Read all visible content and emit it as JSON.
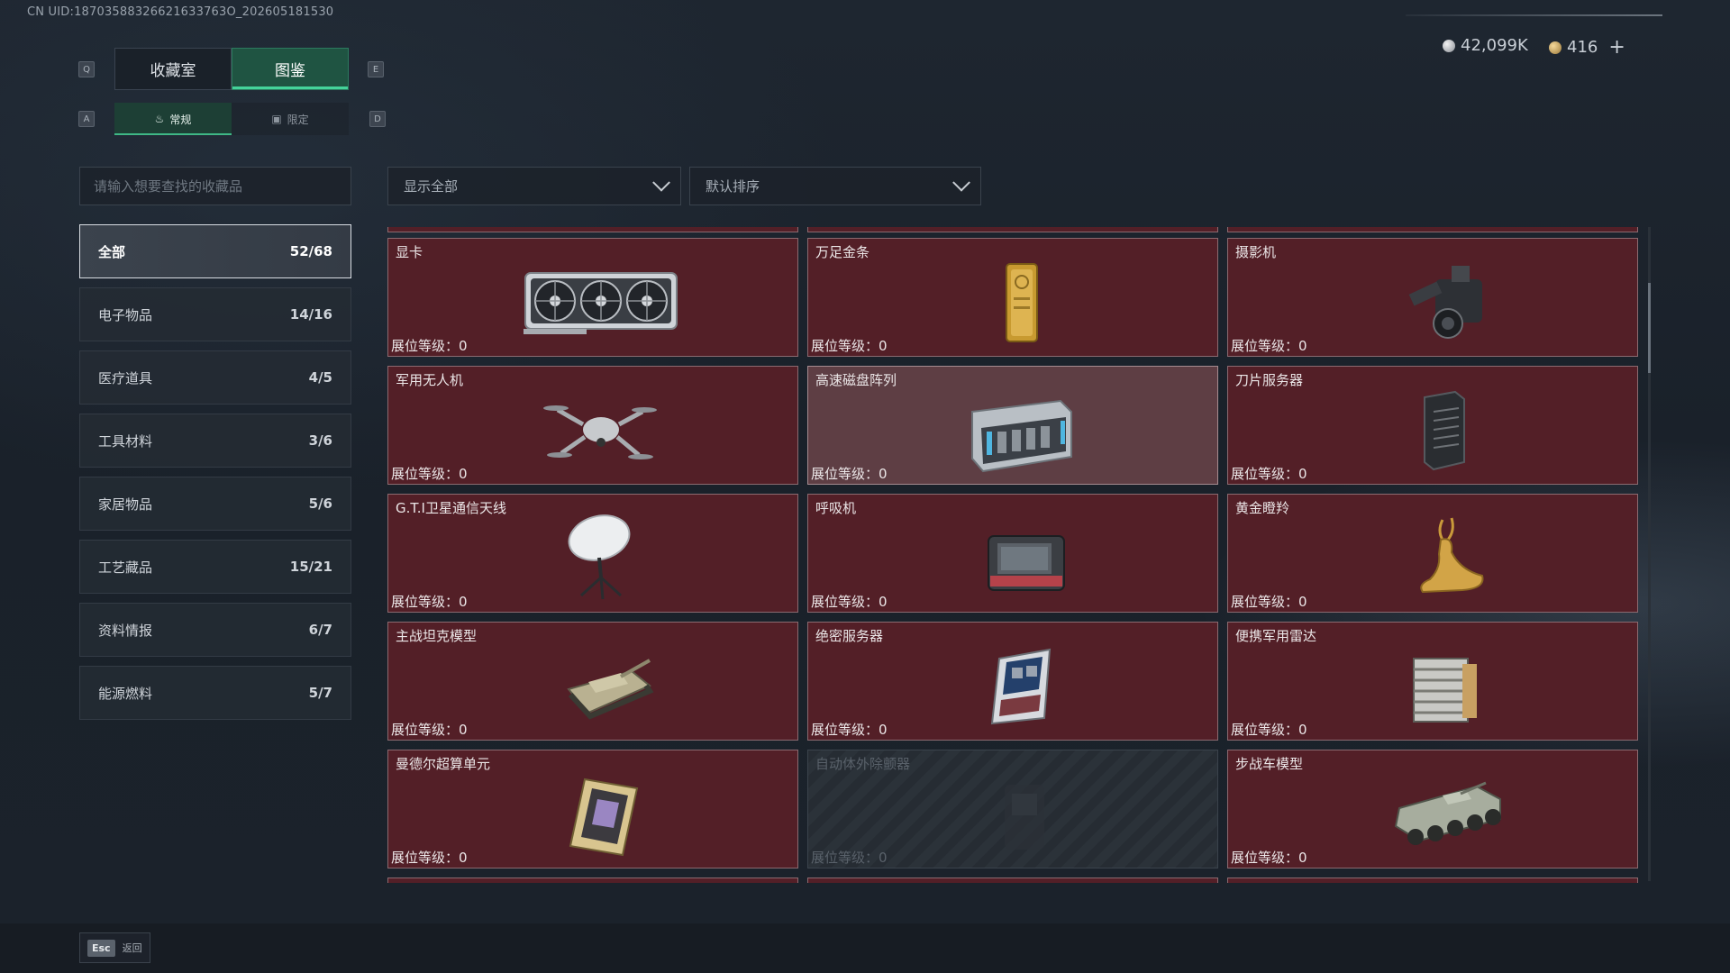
{
  "uid": "CN UID:18703588326621633763O_202605181530",
  "currency": {
    "silver": "42,099K",
    "gold": "416",
    "plus": "+"
  },
  "keys": {
    "prev_tab": "Q",
    "next_tab": "E",
    "prev_sub": "A",
    "next_sub": "D"
  },
  "tabs": [
    "收藏室",
    "图鉴"
  ],
  "subtabs": [
    "常规",
    "限定"
  ],
  "search": {
    "placeholder": "请输入想要查找的收藏品"
  },
  "filter": {
    "label": "显示全部"
  },
  "sort": {
    "label": "默认排序"
  },
  "categories": [
    {
      "label": "全部",
      "count": "52/68"
    },
    {
      "label": "电子物品",
      "count": "14/16"
    },
    {
      "label": "医疗道具",
      "count": "4/5"
    },
    {
      "label": "工具材料",
      "count": "3/6"
    },
    {
      "label": "家居物品",
      "count": "5/6"
    },
    {
      "label": "工艺藏品",
      "count": "15/21"
    },
    {
      "label": "资料情报",
      "count": "6/7"
    },
    {
      "label": "能源燃料",
      "count": "5/7"
    }
  ],
  "items": [
    {
      "name": "显卡",
      "level": "展位等级：0",
      "icon": "graphics-card"
    },
    {
      "name": "万足金条",
      "level": "展位等级：0",
      "icon": "gold-bar"
    },
    {
      "name": "摄影机",
      "level": "展位等级：0",
      "icon": "camera"
    },
    {
      "name": "军用无人机",
      "level": "展位等级：0",
      "icon": "drone"
    },
    {
      "name": "高速磁盘阵列",
      "level": "展位等级：0",
      "icon": "disk-array"
    },
    {
      "name": "刀片服务器",
      "level": "展位等级：0",
      "icon": "blade-server"
    },
    {
      "name": "G.T.I卫星通信天线",
      "level": "展位等级：0",
      "icon": "satellite-dish"
    },
    {
      "name": "呼吸机",
      "level": "展位等级：0",
      "icon": "ventilator"
    },
    {
      "name": "黄金瞪羚",
      "level": "展位等级：0",
      "icon": "gold-gazelle"
    },
    {
      "name": "主战坦克模型",
      "level": "展位等级：0",
      "icon": "tank"
    },
    {
      "name": "绝密服务器",
      "level": "展位等级：0",
      "icon": "server"
    },
    {
      "name": "便携军用雷达",
      "level": "展位等级：0",
      "icon": "radar"
    },
    {
      "name": "曼德尔超算单元",
      "level": "展位等级：0",
      "icon": "cpu-unit"
    },
    {
      "name": "自动体外除颤器",
      "level": "展位等级：0",
      "icon": "defibrillator"
    },
    {
      "name": "步战车模型",
      "level": "展位等级：0",
      "icon": "ifv"
    }
  ],
  "footer": {
    "key": "Esc",
    "label": "返回"
  }
}
